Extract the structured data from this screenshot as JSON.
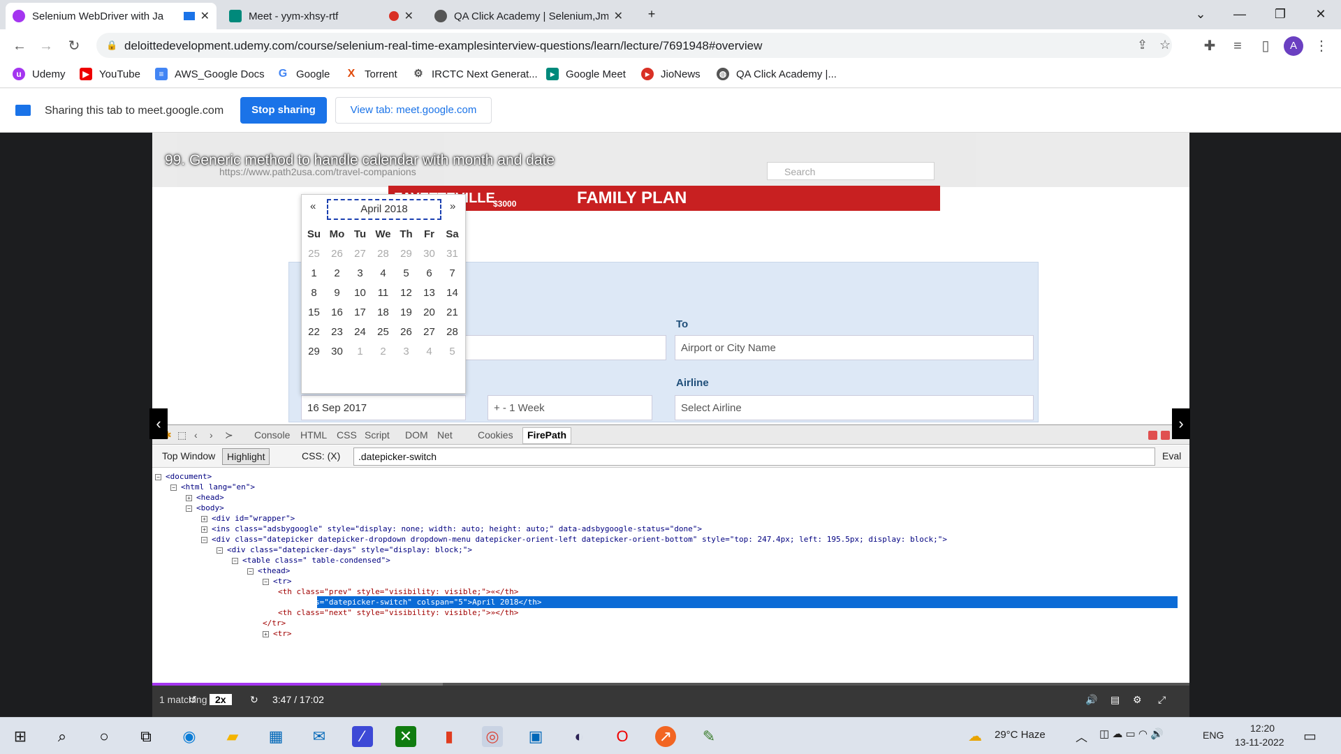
{
  "browser": {
    "tabs": [
      {
        "title": "Selenium WebDriver with Ja",
        "active": true
      },
      {
        "title": "Meet - yym-xhsy-rtf",
        "active": false
      },
      {
        "title": "QA Click Academy | Selenium,Jm",
        "active": false
      }
    ],
    "new_tab": "+",
    "window": {
      "chevron": "⌄",
      "minimize": "—",
      "maximize": "❐",
      "close": "✕"
    },
    "url": "deloittedevelopment.udemy.com/course/selenium-real-time-examplesinterview-questions/learn/lecture/7691948#overview",
    "profile_initial": "A",
    "bookmarks": [
      "Udemy",
      "YouTube",
      "AWS_Google Docs",
      "Google",
      "Torrent",
      "IRCTC Next Generat...",
      "Google Meet",
      "JioNews",
      "QA Click Academy |..."
    ]
  },
  "sharing": {
    "text": "Sharing this tab to meet.google.com",
    "stop_label": "Stop sharing",
    "view_label": "View tab: meet.google.com"
  },
  "video": {
    "title": "99. Generic method to handle calendar with month and date",
    "inner_url": "https://www.path2usa.com/travel-companions",
    "inner_search_placeholder": "Search",
    "banner_text": "FAMILY PLAN",
    "banner_left": "FAYETTEVILLE",
    "banner_price": "$3000",
    "form": {
      "to_label": "To",
      "to_placeholder": "Airport or City Name",
      "airline_label": "Airline",
      "airline_placeholder": "Select Airline",
      "date_value": "16 Sep 2017",
      "flex_value": "+ - 1 Week"
    },
    "datepicker": {
      "prev": "«",
      "next": "»",
      "switch": "April 2018",
      "dow": [
        "Su",
        "Mo",
        "Tu",
        "We",
        "Th",
        "Fr",
        "Sa"
      ],
      "weeks": [
        [
          "25",
          "26",
          "27",
          "28",
          "29",
          "30",
          "31"
        ],
        [
          "1",
          "2",
          "3",
          "4",
          "5",
          "6",
          "7"
        ],
        [
          "8",
          "9",
          "10",
          "11",
          "12",
          "13",
          "14"
        ],
        [
          "15",
          "16",
          "17",
          "18",
          "19",
          "20",
          "21"
        ],
        [
          "22",
          "23",
          "24",
          "25",
          "26",
          "27",
          "28"
        ],
        [
          "29",
          "30",
          "1",
          "2",
          "3",
          "4",
          "5"
        ]
      ]
    },
    "devtools": {
      "tabs": [
        "Console",
        "HTML",
        "CSS",
        "Script",
        "DOM",
        "Net",
        "Cookies",
        "FirePath"
      ],
      "top_window": "Top Window",
      "highlight": "Highlight",
      "css_label": "CSS: (X)",
      "xpath_value": ".datepicker-switch",
      "eval": "Eval",
      "dom_lines": [
        "<document>",
        "<html lang=\"en\">",
        "<head>",
        "<body>",
        "<div id=\"wrapper\">",
        "<ins class=\"adsbygoogle\" style=\"display: none; width: auto; height: auto;\" data-adsbygoogle-status=\"done\">",
        "<div class=\"datepicker datepicker-dropdown dropdown-menu datepicker-orient-left datepicker-orient-bottom\" style=\"top: 247.4px; left: 195.5px; display: block;\">",
        "<div class=\"datepicker-days\" style=\"display: block;\">",
        "<table class=\" table-condensed\">",
        "<thead>",
        "<tr>",
        "<th class=\"prev\" style=\"visibility: visible;\">«</th>",
        "<th class=\"datepicker-switch\" colspan=\"5\">April 2018</th>",
        "<th class=\"next\" style=\"visibility: visible;\">»</th>",
        "</tr>",
        "<tr>"
      ],
      "selected_line": 12
    },
    "player": {
      "matching": "1 matching",
      "speed": "2x",
      "time": "3:47 / 17:02",
      "progress": 0.22,
      "buffered": 0.28
    }
  },
  "taskbar": {
    "weather": "29°C  Haze",
    "lang": "ENG",
    "time": "12:20",
    "date": "13-11-2022"
  },
  "colors": {
    "accent": "#1a73e8",
    "selection": "#0b6bd6",
    "banner": "#c82021",
    "form_bg": "#dde8f6"
  }
}
